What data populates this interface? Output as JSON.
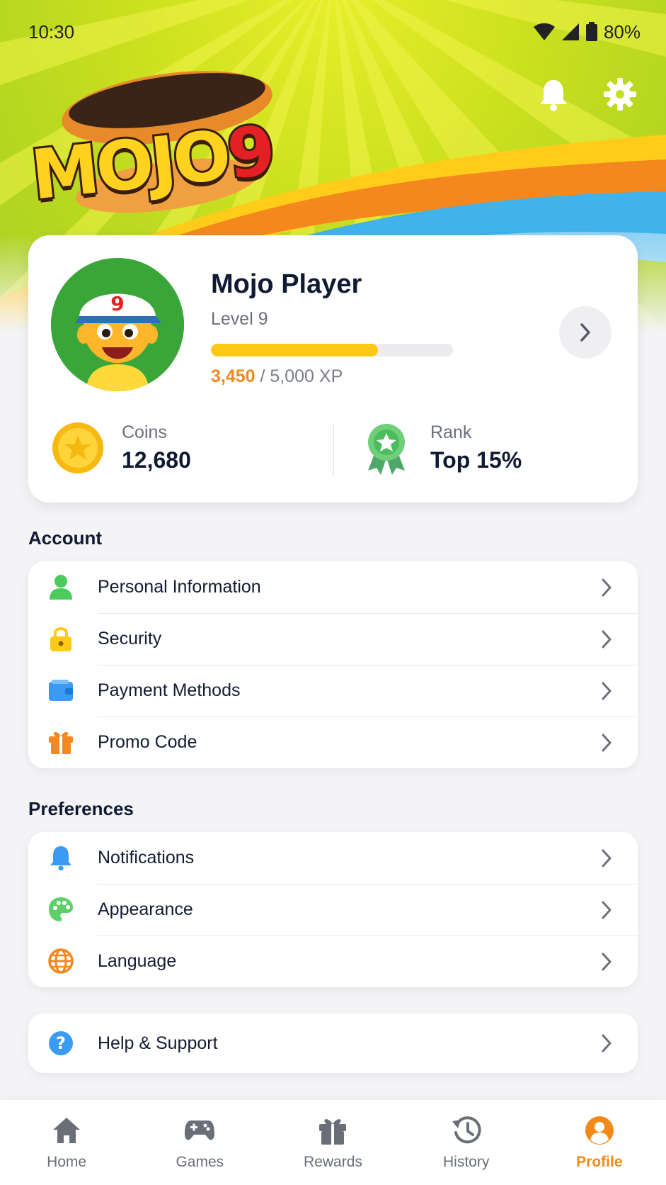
{
  "status_bar": {
    "time": "10:30",
    "battery": "80%"
  },
  "header": {
    "logo_text": "MOJO",
    "logo_number": "9",
    "notification_icon": "bell-icon",
    "settings_icon": "gear-icon"
  },
  "profile": {
    "name": "Mojo Player",
    "level": "Level 9",
    "xp_current": "3,450",
    "xp_total": " / 5,000 XP",
    "xp_progress": 0.69,
    "avatar_badge": "9",
    "coins_label": "Coins",
    "coins_value": "12,680",
    "rank_label": "Rank",
    "rank_value": "Top 15%"
  },
  "account": {
    "title": "Account",
    "items": [
      {
        "label": "Personal Information",
        "icon": "person-icon",
        "color": "#4ccb5c"
      },
      {
        "label": "Security",
        "icon": "lock-icon",
        "color": "#ffc918"
      },
      {
        "label": "Payment Methods",
        "icon": "wallet-icon",
        "color": "#3b9bf3"
      },
      {
        "label": "Promo Code",
        "icon": "gift-icon",
        "color": "#f5871f"
      }
    ]
  },
  "preferences": {
    "title": "Preferences",
    "items": [
      {
        "label": "Notifications",
        "icon": "bell-icon",
        "color": "#3b9bf3"
      },
      {
        "label": "Appearance",
        "icon": "palette-icon",
        "color": "#5fcf6a"
      },
      {
        "label": "Language",
        "icon": "globe-icon",
        "color": "#f5871f"
      }
    ]
  },
  "help": {
    "label": "Help & Support",
    "icon": "question-icon",
    "color": "#3b9bf3"
  },
  "bottom_nav": {
    "items": [
      {
        "label": "Home",
        "icon": "home-icon"
      },
      {
        "label": "Games",
        "icon": "gamepad-icon"
      },
      {
        "label": "Rewards",
        "icon": "gift-icon"
      },
      {
        "label": "History",
        "icon": "history-icon"
      },
      {
        "label": "Profile",
        "icon": "profile-icon"
      }
    ],
    "active": "Profile",
    "accent_color": "#f28a1a"
  }
}
